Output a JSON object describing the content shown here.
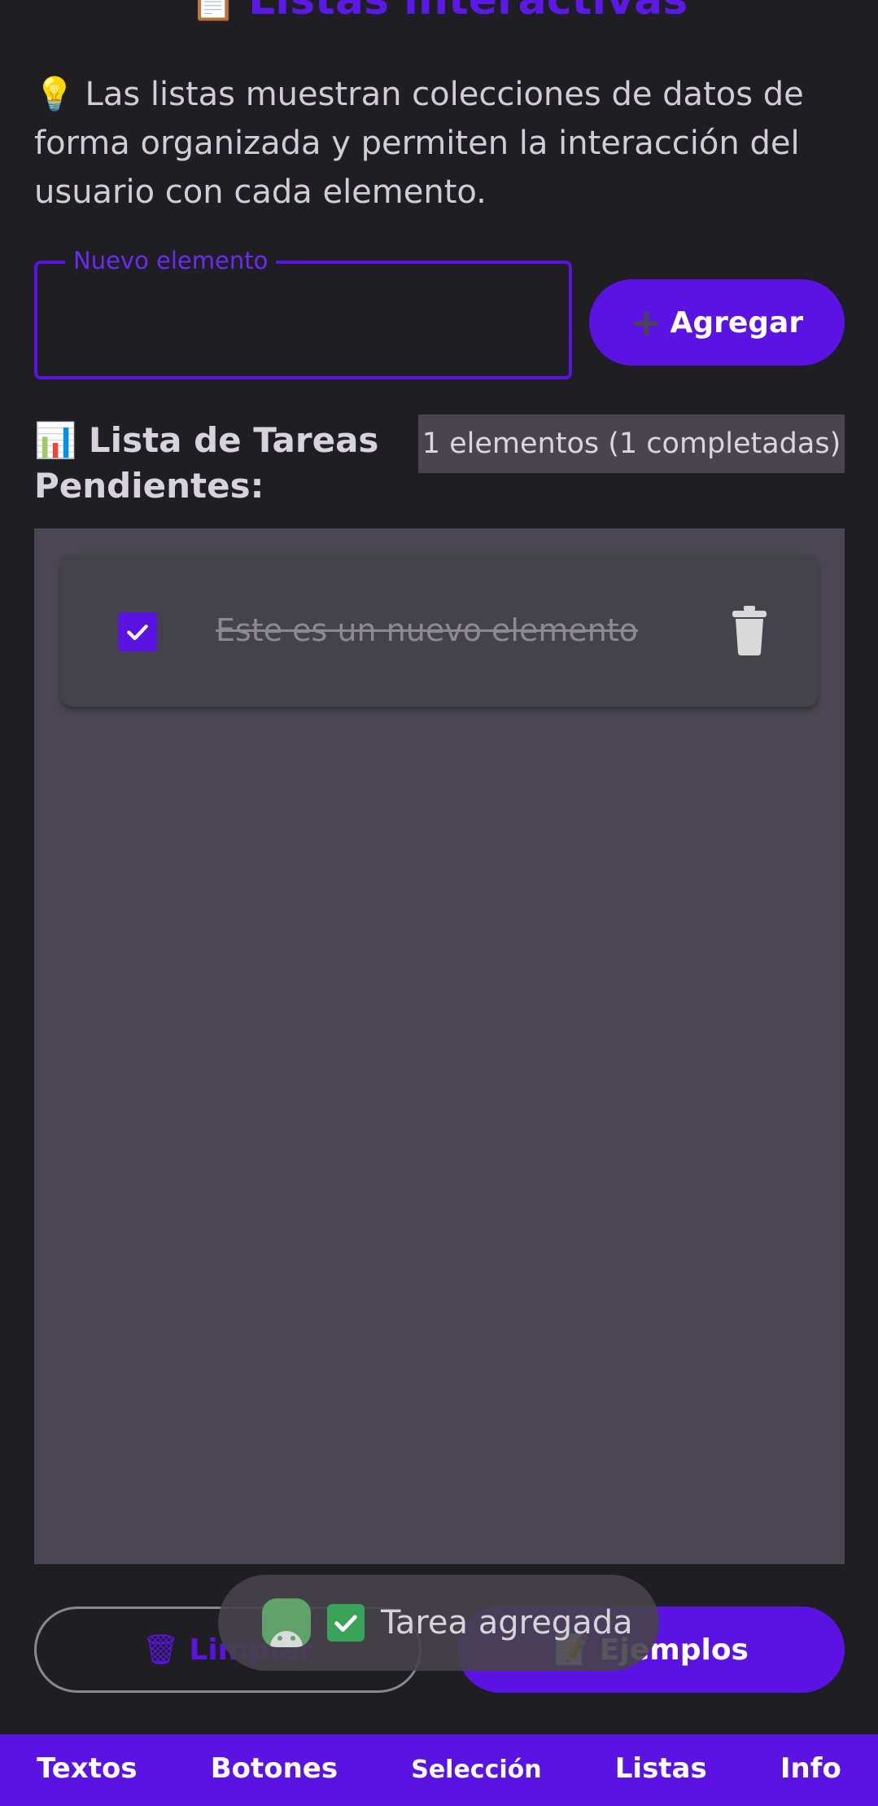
{
  "header": {
    "title": "Listas interactivas",
    "title_icon": "clipboard-icon"
  },
  "intro": {
    "icon": "light-bulb-icon",
    "text": "Las listas muestran colecciones de datos de forma organizada y permiten la interacción del usuario con cada elemento."
  },
  "new_item": {
    "label": "Nuevo elemento",
    "value": "",
    "add_button_icon": "plus-icon",
    "add_button_label": "Agregar"
  },
  "list_section": {
    "title_icon": "bar-chart-icon",
    "title": "Lista de Tareas Pendientes:",
    "count_text": "1 elementos (1 completadas)",
    "items": [
      {
        "text": "Este es un nuevo elemento",
        "checked": true
      }
    ]
  },
  "actions": {
    "clear_icon": "wastebasket-icon",
    "clear_label": "Limpiar",
    "examples_icon": "memo-icon",
    "examples_label": "Ejemplos"
  },
  "toast": {
    "app_icon": "android-icon",
    "check_icon": "check-mark-icon",
    "text": "Tarea agregada"
  },
  "bottom_nav": {
    "tabs": [
      "Textos",
      "Botones",
      "Selección",
      "Listas",
      "Info"
    ]
  },
  "colors": {
    "accent": "#5a13e2",
    "background": "#1f1e22",
    "panel": "#4a4752",
    "card": "#44434a"
  }
}
